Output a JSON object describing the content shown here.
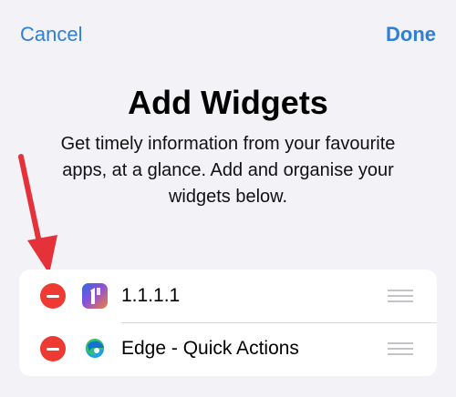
{
  "header": {
    "cancel_label": "Cancel",
    "done_label": "Done"
  },
  "title": "Add Widgets",
  "subtitle": "Get timely information from your favourite apps, at a glance. Add and organise your widgets below.",
  "widgets": [
    {
      "label": "1.1.1.1",
      "icon": "cloudflare-1111-icon"
    },
    {
      "label": "Edge - Quick Actions",
      "icon": "microsoft-edge-icon"
    }
  ],
  "colors": {
    "accent": "#2f7fd6",
    "remove": "#ee3a32",
    "annotation_arrow": "#e5323a",
    "background": "#f2f2f7"
  }
}
